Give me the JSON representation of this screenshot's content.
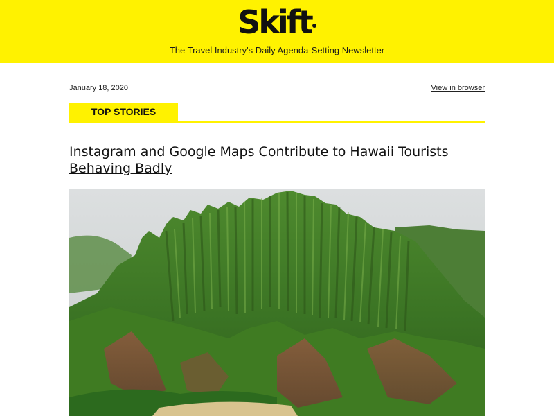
{
  "header": {
    "logo_text": "Skift",
    "tagline": "The Travel Industry's Daily Agenda-Setting Newsletter",
    "background_color": "#fff200"
  },
  "meta": {
    "date": "January 18, 2020",
    "view_in_browser": "View in browser"
  },
  "section": {
    "label": "TOP STORIES"
  },
  "story": {
    "headline": "Instagram and Google Maps Contribute to Hawaii Tourists Behaving Badly",
    "image_subject": "aerial photo of green jagged mountain ridges"
  }
}
